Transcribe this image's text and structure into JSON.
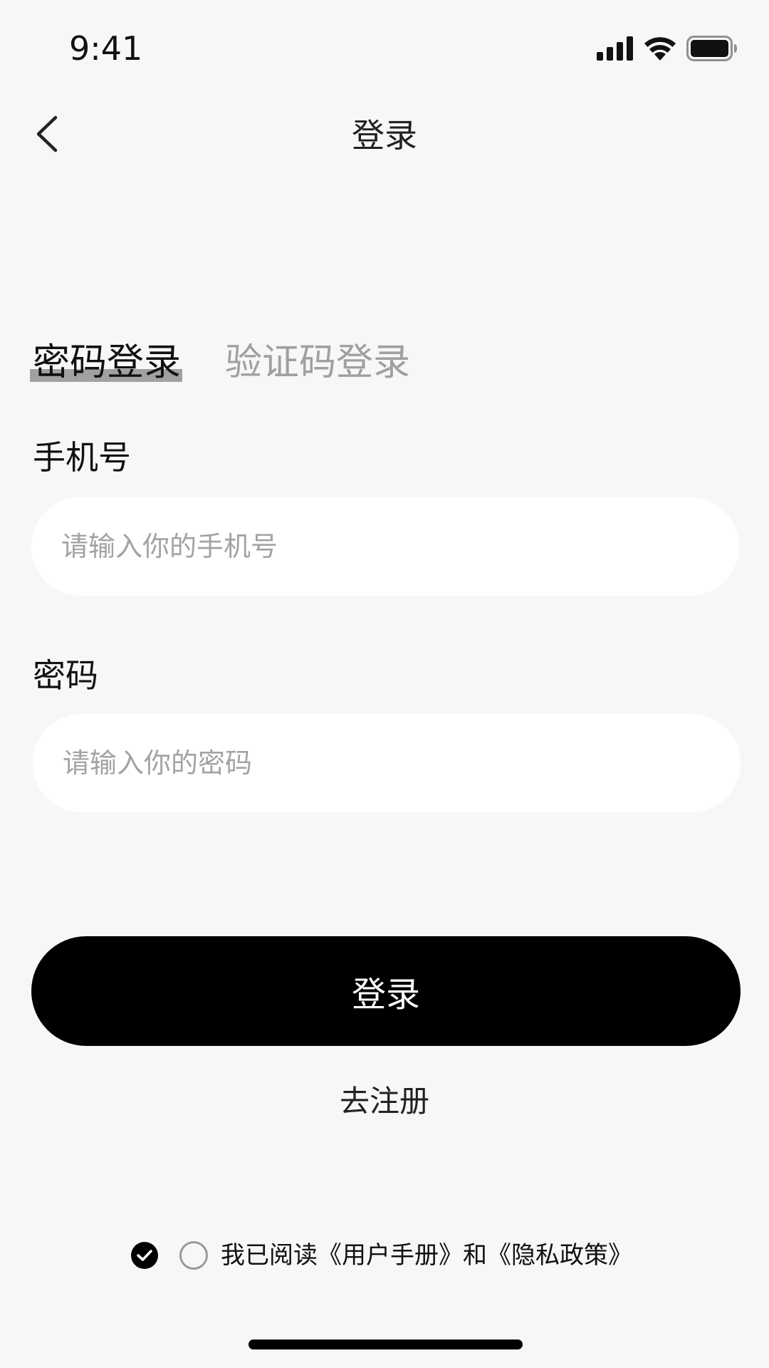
{
  "status_bar": {
    "time": "9:41",
    "icons": [
      "cellular-signal-icon",
      "wifi-icon",
      "battery-icon"
    ]
  },
  "nav": {
    "back_icon": "chevron-left-icon",
    "title": "登录"
  },
  "tabs": [
    {
      "label": "密码登录",
      "active": true
    },
    {
      "label": "验证码登录",
      "active": false
    }
  ],
  "form": {
    "phone": {
      "label": "手机号",
      "placeholder": "请输入你的手机号",
      "value": ""
    },
    "password": {
      "label": "密码",
      "placeholder": "请输入你的密码",
      "value": ""
    }
  },
  "actions": {
    "login_label": "登录",
    "register_label": "去注册"
  },
  "agreement": {
    "text": "我已阅读《用户手册》和《隐私政策》",
    "checked_icon": "check-circle-filled-icon",
    "unchecked_icon": "radio-empty-icon"
  },
  "colors": {
    "background": "#F6F7F9",
    "primary": "#000000",
    "placeholder": "#A3A3A3",
    "inactive_tab": "#A0A0A0",
    "input_bg": "#FFFFFF"
  }
}
